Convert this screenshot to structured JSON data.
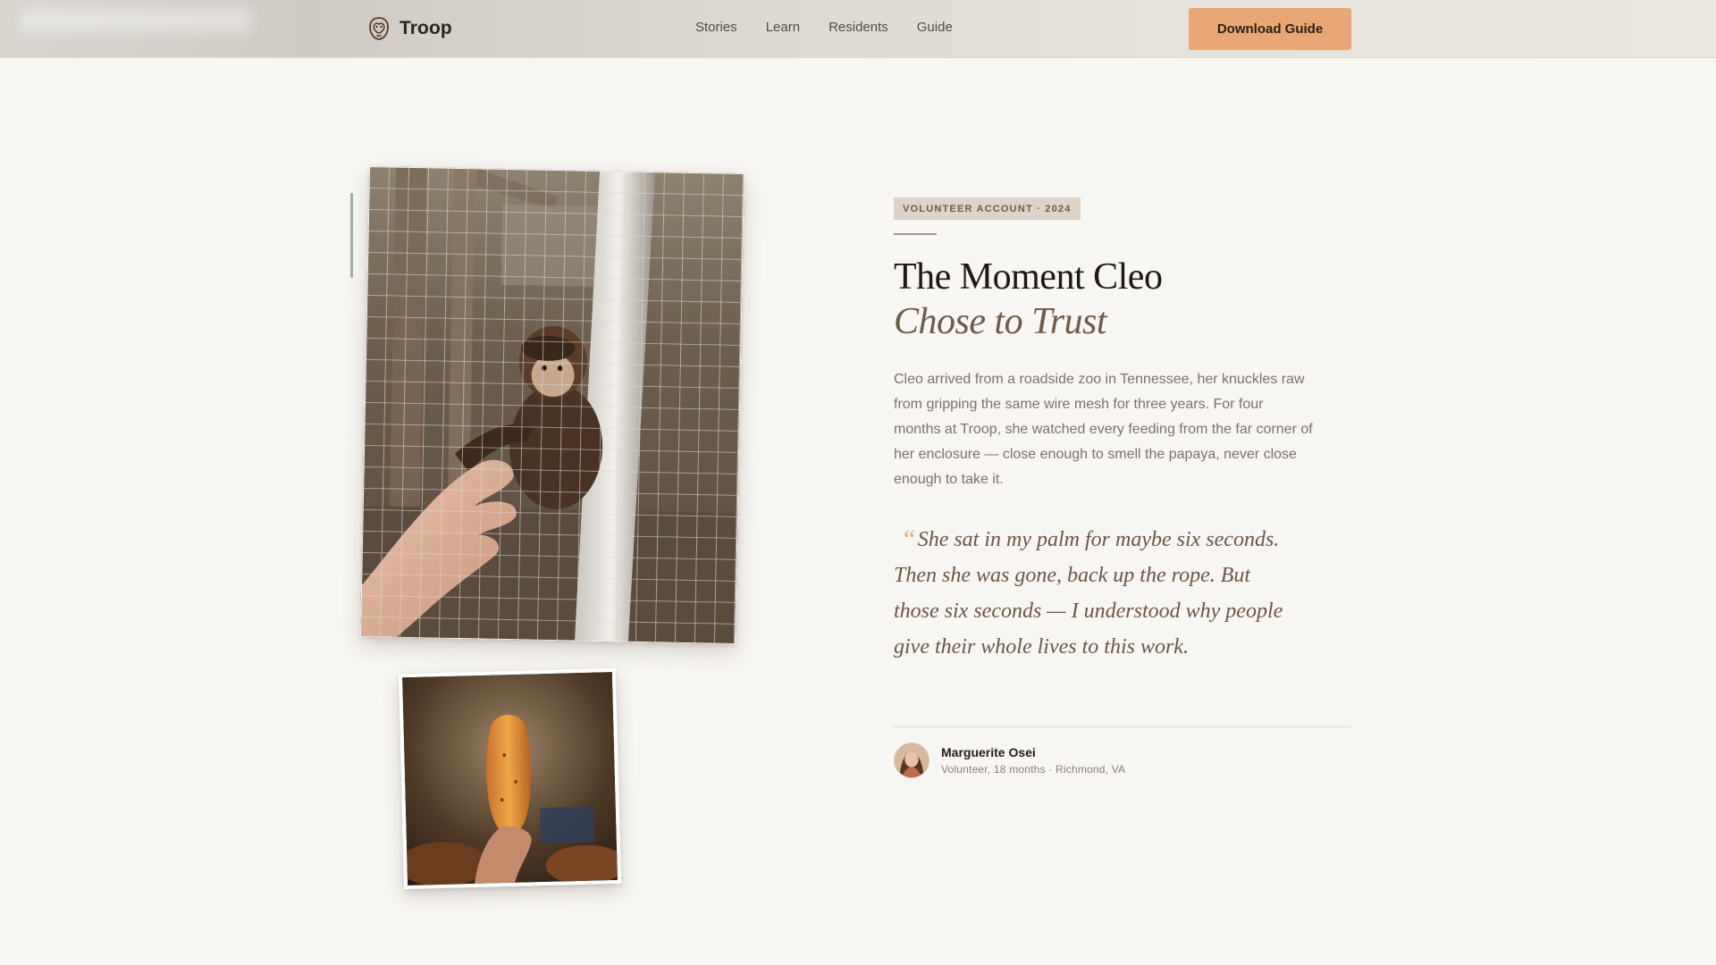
{
  "header": {
    "brand_name": "Troop",
    "brand_icon": "monkey-face-icon",
    "nav": [
      "Stories",
      "Learn",
      "Residents",
      "Guide"
    ],
    "cta_label": "Download Guide",
    "accent_color": "#e9a677"
  },
  "article": {
    "badge": "VOLUNTEER ACCOUNT · 2024",
    "title_line1": "The Moment Cleo",
    "title_line2": "Chose to Trust",
    "lede": "Cleo arrived from a roadside zoo in Tennessee, her knuckles raw from gripping the same wire mesh for three years. For four months at Troop, she watched every feeding from the far corner of her enclosure — close enough to smell the papaya, never close enough to take it.",
    "quote_mark": "“",
    "quote": "She sat in my palm for maybe six seconds. Then she was gone, back up the rope. But those six seconds — I understood why people give their whole lives to this work."
  },
  "author": {
    "name": "Marguerite Osei",
    "meta": "Volunteer, 18 months · Richmond, VA"
  },
  "photos": {
    "main": "monkey reaching through wire cage to a hand",
    "secondary": "hand holding a papaya"
  }
}
